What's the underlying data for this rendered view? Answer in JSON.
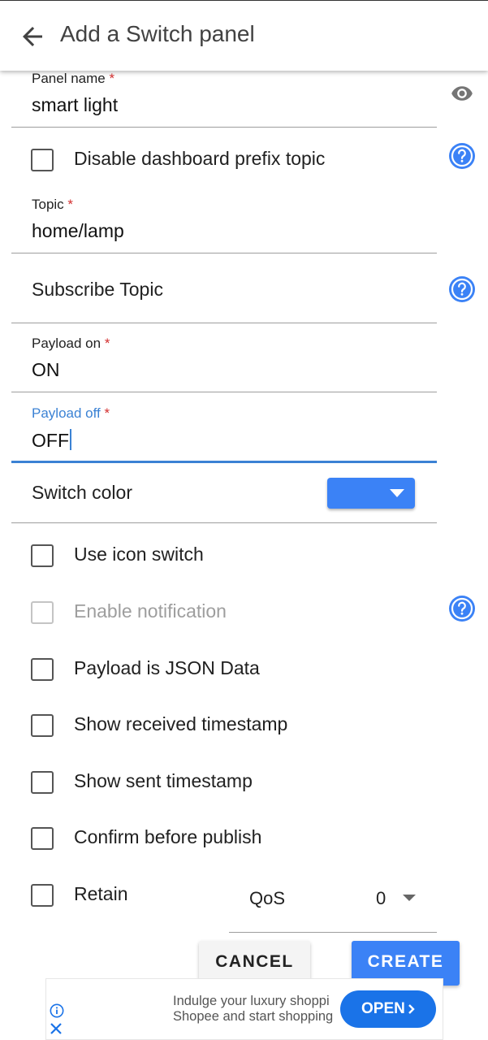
{
  "appbar": {
    "title": "Add a Switch panel",
    "back_icon": "arrow-back-icon"
  },
  "panel_name": {
    "label": "Panel name",
    "required_mark": "*",
    "value": "smart light"
  },
  "disable_prefix": {
    "label": "Disable dashboard prefix topic",
    "checked": false
  },
  "topic": {
    "label": "Topic",
    "required_mark": "*",
    "value": "home/lamp"
  },
  "subscribe_topic": {
    "placeholder": "Subscribe Topic"
  },
  "payload_on": {
    "label": "Payload on",
    "required_mark": "*",
    "value": "ON"
  },
  "payload_off": {
    "label": "Payload off",
    "required_mark": "*",
    "value": "OFF"
  },
  "switch_color": {
    "label": "Switch color",
    "color": "#3b82f6"
  },
  "options": {
    "use_icon_switch": "Use icon switch",
    "enable_notification": "Enable notification",
    "payload_json": "Payload is JSON Data",
    "show_received_timestamp": "Show received timestamp",
    "show_sent_timestamp": "Show sent timestamp",
    "confirm_before_publish": "Confirm before publish",
    "retain": "Retain"
  },
  "qos": {
    "label": "QoS",
    "value": "0"
  },
  "actions": {
    "cancel": "CANCEL",
    "create": "CREATE"
  },
  "ad": {
    "line1": "Indulge your luxury shoppi",
    "line2": "Shopee and start shopping",
    "open": "OPEN"
  },
  "colors": {
    "accent": "#3b82f6",
    "focus": "#3b82d4",
    "required": "#d32f2f"
  }
}
